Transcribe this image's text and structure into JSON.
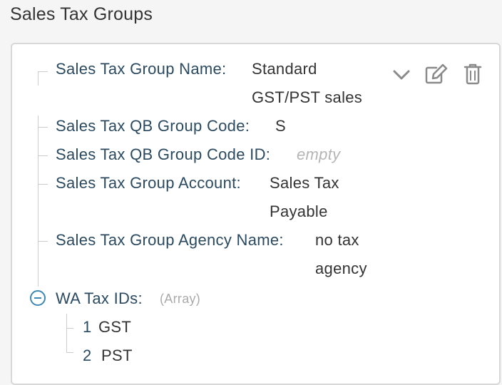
{
  "page_title": "Sales Tax Groups",
  "record": {
    "group_name": {
      "label": "Sales Tax Group Name:",
      "value_line1": "Standard",
      "value_line2": "GST/PST sales"
    },
    "qb_group_code": {
      "label": "Sales Tax QB Group Code:",
      "value": "S"
    },
    "qb_group_code_id": {
      "label": "Sales Tax QB Group Code ID:",
      "value": "empty"
    },
    "group_account": {
      "label": "Sales Tax Group Account:",
      "value_line1": "Sales Tax",
      "value_line2": "Payable"
    },
    "agency_name": {
      "label": "Sales Tax Group Agency Name:",
      "value_line1": "no tax",
      "value_line2": "agency"
    },
    "wa_tax_ids": {
      "label": "WA Tax IDs:",
      "type_tag": "(Array)",
      "items": [
        {
          "index": "1",
          "value": "GST"
        },
        {
          "index": "2",
          "value": "PST"
        }
      ]
    }
  },
  "actions": {
    "expand_icon": "chevron-down-icon",
    "edit_icon": "edit-icon",
    "delete_icon": "trash-icon"
  },
  "colors": {
    "key": "#2b4a60",
    "value": "#333333",
    "placeholder": "#b5b5b5",
    "toggle": "#3d87b5",
    "icon": "#8a8a8a"
  }
}
